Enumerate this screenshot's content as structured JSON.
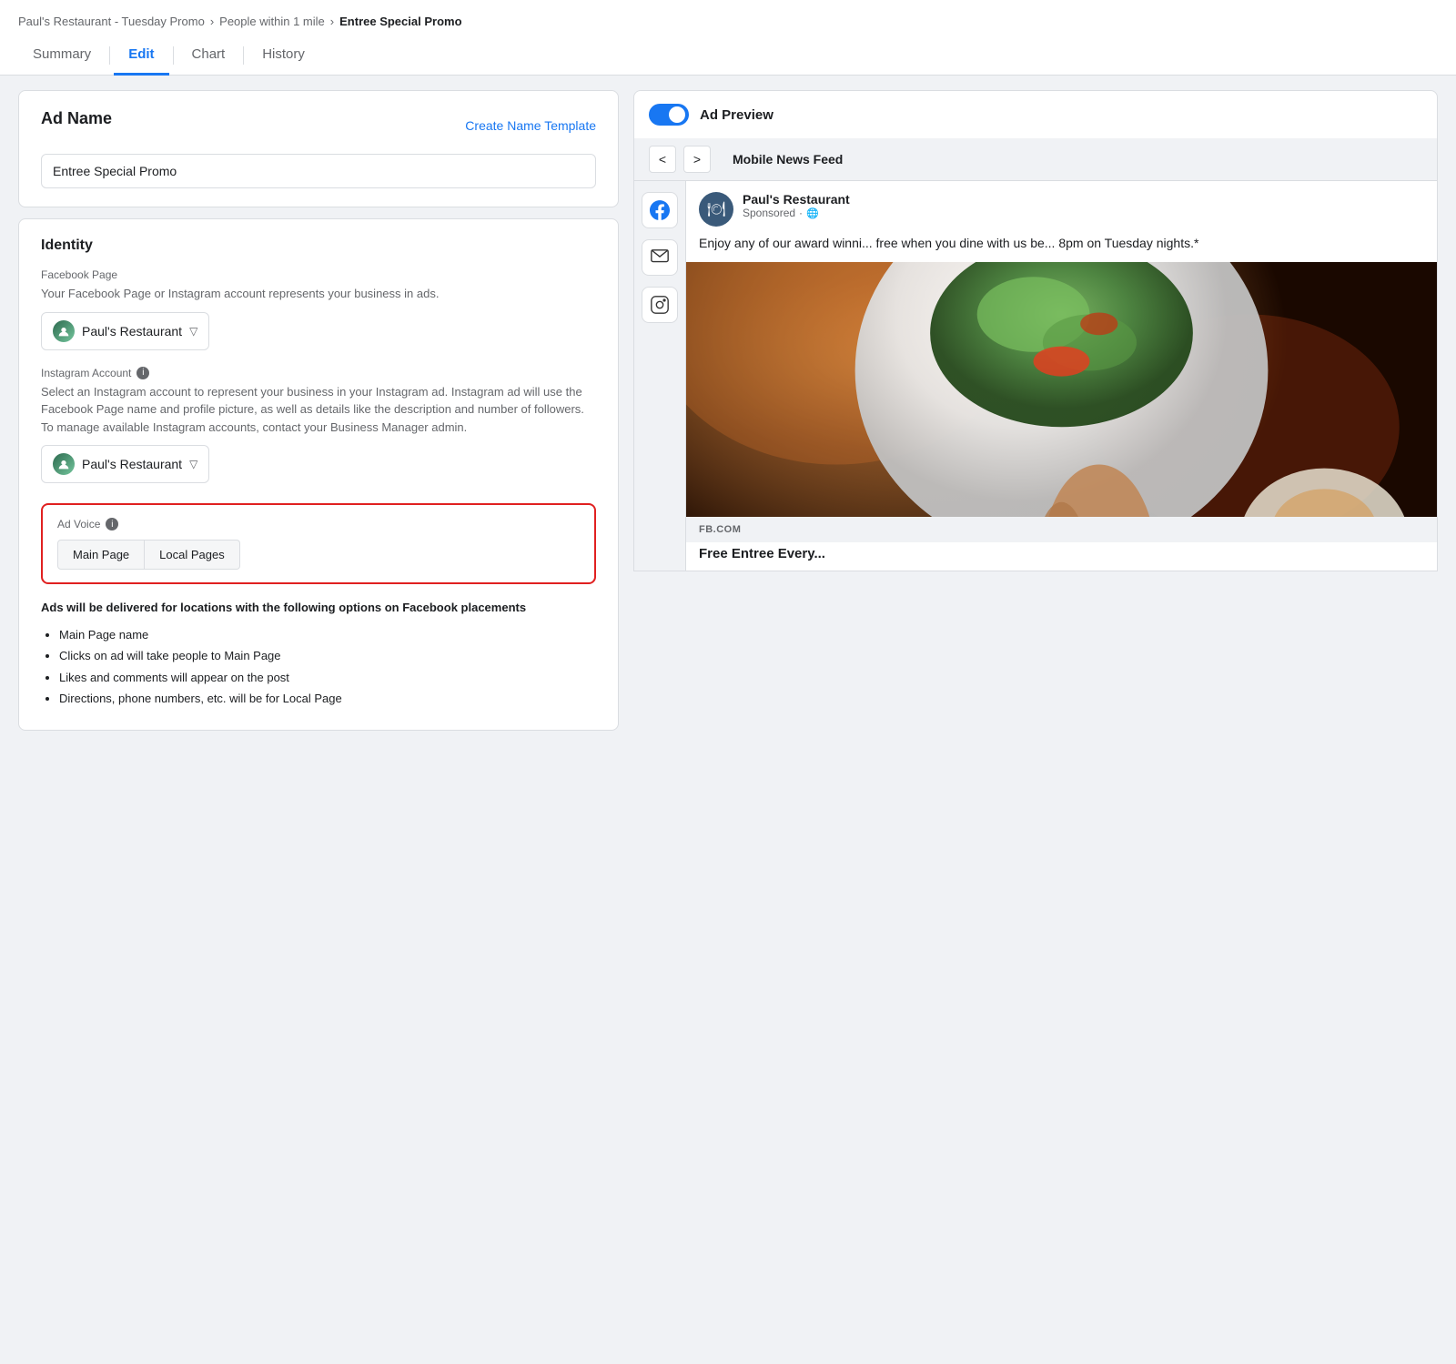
{
  "breadcrumb": {
    "items": [
      {
        "label": "Paul's Restaurant - Tuesday Promo"
      },
      {
        "label": "People within 1 mile"
      },
      {
        "label": "Entree Special Promo",
        "current": true
      }
    ],
    "sep": ">"
  },
  "tabs": [
    {
      "id": "summary",
      "label": "Summary",
      "active": false
    },
    {
      "id": "edit",
      "label": "Edit",
      "active": true
    },
    {
      "id": "chart",
      "label": "Chart",
      "active": false
    },
    {
      "id": "history",
      "label": "History",
      "active": false
    }
  ],
  "ad_name_section": {
    "title": "Ad Name",
    "create_template_link": "Create Name Template",
    "input_value": "Entree Special Promo"
  },
  "identity_section": {
    "title": "Identity",
    "facebook_page": {
      "label": "Facebook Page",
      "description": "Your Facebook Page or Instagram account represents your business in ads.",
      "selected": "Paul's Restaurant"
    },
    "instagram_account": {
      "label": "Instagram Account",
      "description": "Select an Instagram account to represent your business in your Instagram ad. Instagram ad will use the Facebook Page name and profile picture, as well as details like the description and number of followers. To manage available Instagram accounts, contact your Business Manager admin.",
      "selected": "Paul's Restaurant"
    },
    "ad_voice": {
      "label": "Ad Voice",
      "buttons": [
        {
          "label": "Main Page",
          "id": "main-page"
        },
        {
          "label": "Local Pages",
          "id": "local-pages"
        }
      ]
    },
    "delivery_note": "Ads will be delivered for locations with the following options on Facebook placements",
    "bullet_points": [
      "Main Page name",
      "Clicks on ad will take people to Main Page",
      "Likes and comments will appear on the post",
      "Directions, phone numbers, etc. will be for Local Page"
    ]
  },
  "ad_preview": {
    "label": "Ad Preview",
    "toggle_on": true,
    "nav_prev": "<",
    "nav_next": ">",
    "feed_type": "Mobile News Feed",
    "advertiser": {
      "name": "Paul's Restaurant",
      "sponsored": "Sponsored",
      "globe": "🌐"
    },
    "body_text": "Enjoy any of our award winni... free when you dine with us be... 8pm on Tuesday nights.*",
    "fb_com": "FB.COM",
    "link_text": "Free Entree Every..."
  },
  "platform_icons": [
    {
      "id": "facebook",
      "symbol": "f",
      "active": true
    },
    {
      "id": "messenger",
      "symbol": "m",
      "active": false
    },
    {
      "id": "instagram",
      "symbol": "IG",
      "active": false
    }
  ]
}
